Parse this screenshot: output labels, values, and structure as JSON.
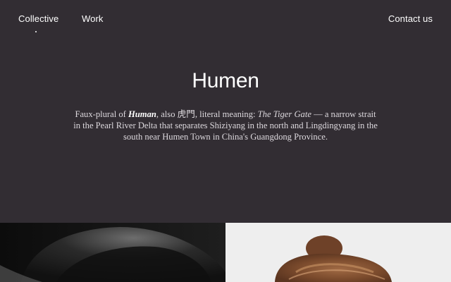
{
  "nav": {
    "brand": "Collective",
    "work": "Work",
    "contact": "Contact us"
  },
  "hero": {
    "title": "Humen",
    "desc_prefix": "Faux-plural of ",
    "desc_bold": "Human",
    "desc_mid": ", also 虎門, literal meaning: ",
    "desc_italic": "The Tiger Gate",
    "desc_suffix": " — a narrow strait in the Pearl River Delta that separates Shiziyang in the north and Lingdingyang in the south near Humen Town in China's Guangdong Province."
  },
  "colors": {
    "background": "#322d33",
    "text": "#ffffff",
    "desc_text": "#ddd9de"
  }
}
